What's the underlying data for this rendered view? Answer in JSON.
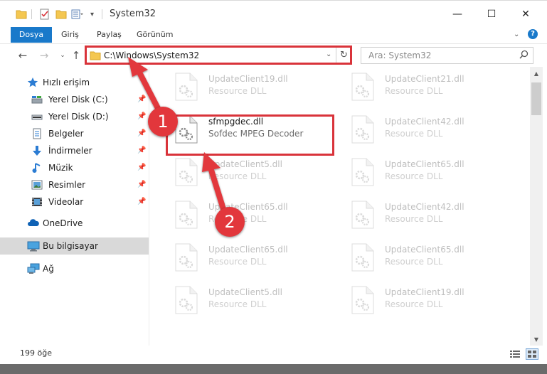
{
  "window": {
    "title": "System32",
    "minimize_glyph": "—",
    "maximize_glyph": "☐",
    "close_glyph": "✕"
  },
  "ribbon": {
    "tabs": [
      {
        "label": "Dosya"
      },
      {
        "label": "Giriş"
      },
      {
        "label": "Paylaş"
      },
      {
        "label": "Görünüm"
      }
    ]
  },
  "address": {
    "path": "C:\\Windows\\System32",
    "search_placeholder": "Ara: System32"
  },
  "sidebar": {
    "quick_access": "Hızlı erişim",
    "items": [
      {
        "label": "Yerel Disk (C:)",
        "icon": "drive-icon"
      },
      {
        "label": "Yerel Disk (D:)",
        "icon": "drive-icon"
      },
      {
        "label": "Belgeler",
        "icon": "documents-icon"
      },
      {
        "label": "İndirmeler",
        "icon": "download-icon"
      },
      {
        "label": "Müzik",
        "icon": "music-icon"
      },
      {
        "label": "Resimler",
        "icon": "pictures-icon"
      },
      {
        "label": "Videolar",
        "icon": "videos-icon"
      }
    ],
    "onedrive": "OneDrive",
    "this_pc": "Bu bilgisayar",
    "network": "Ağ"
  },
  "files": [
    {
      "name": "UpdateClient19.dll",
      "type": "Resource DLL"
    },
    {
      "name": "UpdateClient21.dll",
      "type": "Resource DLL"
    },
    {
      "name": "sfmpgdec.dll",
      "type": "Sofdec MPEG Decoder"
    },
    {
      "name": "UpdateClient42.dll",
      "type": "Resource DLL"
    },
    {
      "name": "UpdateClient5.dll",
      "type": "Resource DLL"
    },
    {
      "name": "UpdateClient65.dll",
      "type": "Resource DLL"
    },
    {
      "name": "UpdateClient65.dll",
      "type": "Resource DLL"
    },
    {
      "name": "UpdateClient42.dll",
      "type": "Resource DLL"
    },
    {
      "name": "UpdateClient65.dll",
      "type": "Resource DLL"
    },
    {
      "name": "UpdateClient65.dll",
      "type": "Resource DLL"
    },
    {
      "name": "UpdateClient5.dll",
      "type": "Resource DLL"
    },
    {
      "name": "UpdateClient19.dll",
      "type": "Resource DLL"
    }
  ],
  "status": {
    "count": "199 öğe"
  },
  "annotations": {
    "step1": "1",
    "step2": "2"
  },
  "colors": {
    "accent": "#1979ca",
    "annotation_red": "#d9333a"
  }
}
